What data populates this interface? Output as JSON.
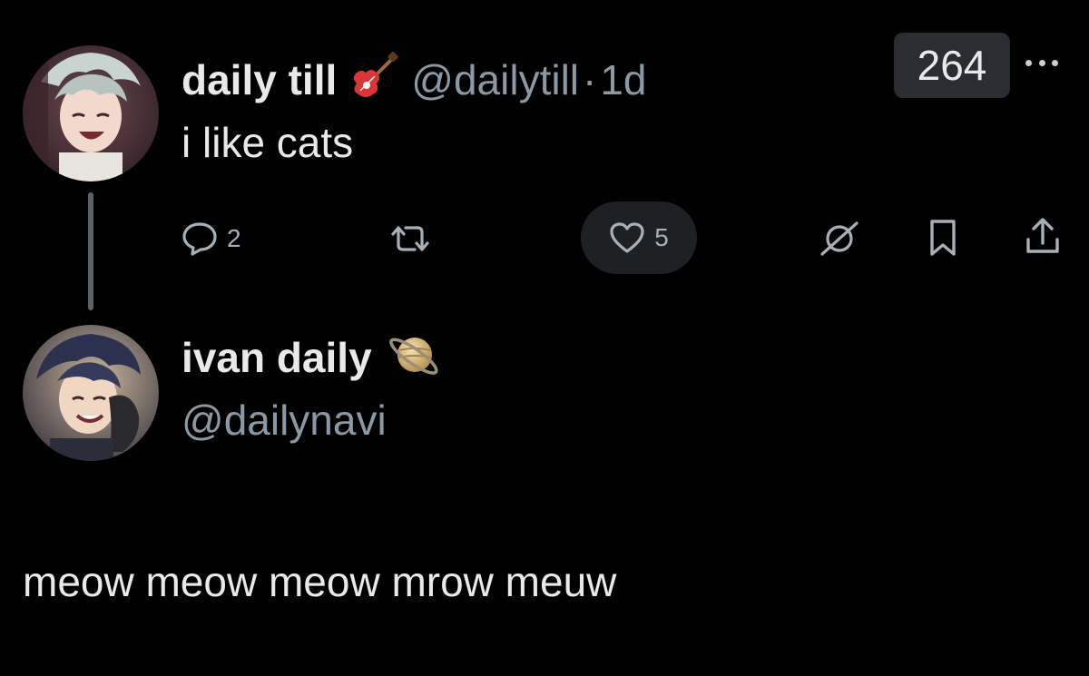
{
  "post": {
    "author_name": "daily till",
    "author_emoji": "guitar-icon",
    "handle": "@dailytill",
    "separator": "·",
    "time": "1d",
    "views": "264",
    "text": "i like cats",
    "actions": {
      "replies": "2",
      "likes": "5"
    }
  },
  "reply": {
    "author_name": "ivan daily",
    "author_emoji": "saturn-icon",
    "handle": "@dailynavi",
    "text": "meow meow meow mrow meuw"
  },
  "colors": {
    "background": "#000000",
    "text": "#e7e9ea",
    "secondary": "#8b98a5",
    "thread_line": "#5b6168",
    "pill": "#1e2124"
  }
}
